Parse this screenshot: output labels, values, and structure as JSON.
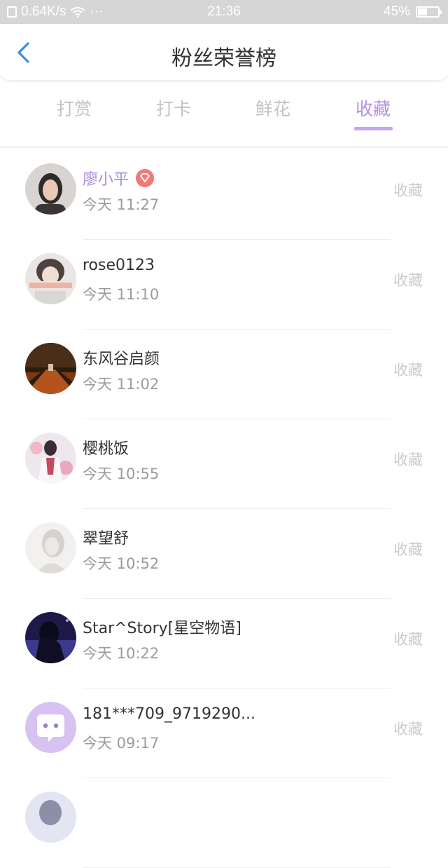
{
  "status_bar": {
    "network_speed": "0.64K/s",
    "dots": "···",
    "time": "21:36",
    "battery": "45%"
  },
  "header": {
    "title": "粉丝荣誉榜"
  },
  "tabs": [
    {
      "label": "打赏",
      "active": false
    },
    {
      "label": "打卡",
      "active": false
    },
    {
      "label": "鲜花",
      "active": false
    },
    {
      "label": "收藏",
      "active": true
    }
  ],
  "fans": [
    {
      "name": "廖小平",
      "time": "今天 11:27",
      "action": "收藏",
      "badge": true
    },
    {
      "name": "rose0123",
      "time": "今天 11:10",
      "action": "收藏",
      "badge": false
    },
    {
      "name": "东风谷启颜",
      "time": "今天 11:02",
      "action": "收藏",
      "badge": false
    },
    {
      "name": "樱桃饭",
      "time": "今天 10:55",
      "action": "收藏",
      "badge": false
    },
    {
      "name": "翠望舒",
      "time": "今天 10:52",
      "action": "收藏",
      "badge": false
    },
    {
      "name": "Star^Story[星空物语]",
      "time": "今天 10:22",
      "action": "收藏",
      "badge": false
    },
    {
      "name": "181***709_9719290...",
      "time": "今天 09:17",
      "action": "收藏",
      "badge": false
    }
  ],
  "colors": {
    "accent": "#b48ee3",
    "highlight_name": "#a98bd9",
    "badge": "#f07a78",
    "back_arrow": "#3b8fe0"
  }
}
